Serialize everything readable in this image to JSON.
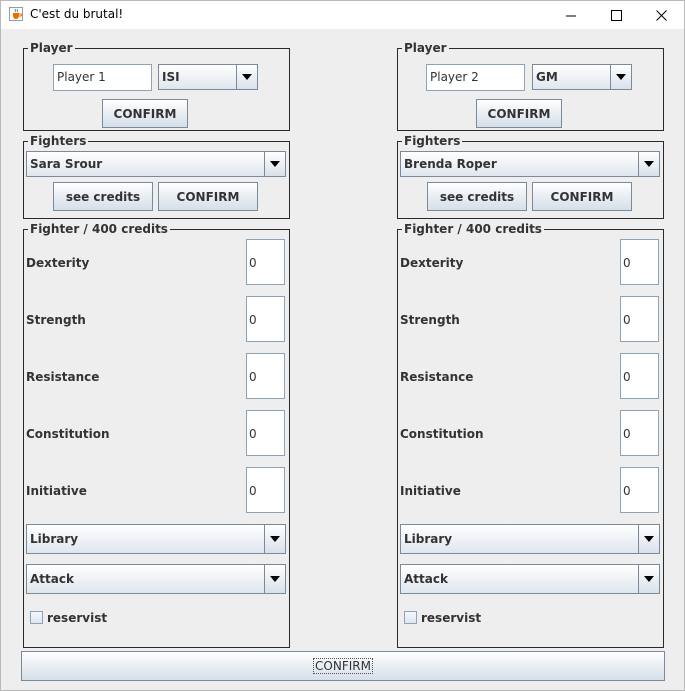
{
  "window": {
    "title": "C'est du brutal!",
    "icon": "java-cup-icon"
  },
  "players": [
    {
      "player_legend": "Player",
      "name_value": "Player 1",
      "school_value": "ISI",
      "confirm_label": "CONFIRM",
      "fighters_legend": "Fighters",
      "fighter_value": "Sara Srour",
      "see_credits_label": "see credits",
      "fighter_confirm_label": "CONFIRM",
      "stats_legend": "Fighter / 400 credits",
      "stats": [
        {
          "label": "Dexterity",
          "value": "0"
        },
        {
          "label": "Strength",
          "value": "0"
        },
        {
          "label": "Resistance",
          "value": "0"
        },
        {
          "label": "Constitution",
          "value": "0"
        },
        {
          "label": "Initiative",
          "value": "0"
        }
      ],
      "strategy_value": "Library",
      "action_value": "Attack",
      "reservist_label": "reservist"
    },
    {
      "player_legend": "Player",
      "name_value": "Player 2",
      "school_value": "GM",
      "confirm_label": "CONFIRM",
      "fighters_legend": "Fighters",
      "fighter_value": "Brenda Roper",
      "see_credits_label": "see credits",
      "fighter_confirm_label": "CONFIRM",
      "stats_legend": "Fighter / 400 credits",
      "stats": [
        {
          "label": "Dexterity",
          "value": "0"
        },
        {
          "label": "Strength",
          "value": "0"
        },
        {
          "label": "Resistance",
          "value": "0"
        },
        {
          "label": "Constitution",
          "value": "0"
        },
        {
          "label": "Initiative",
          "value": "0"
        }
      ],
      "strategy_value": "Library",
      "action_value": "Attack",
      "reservist_label": "reservist"
    }
  ],
  "confirm_all_label": "CONFIRM"
}
